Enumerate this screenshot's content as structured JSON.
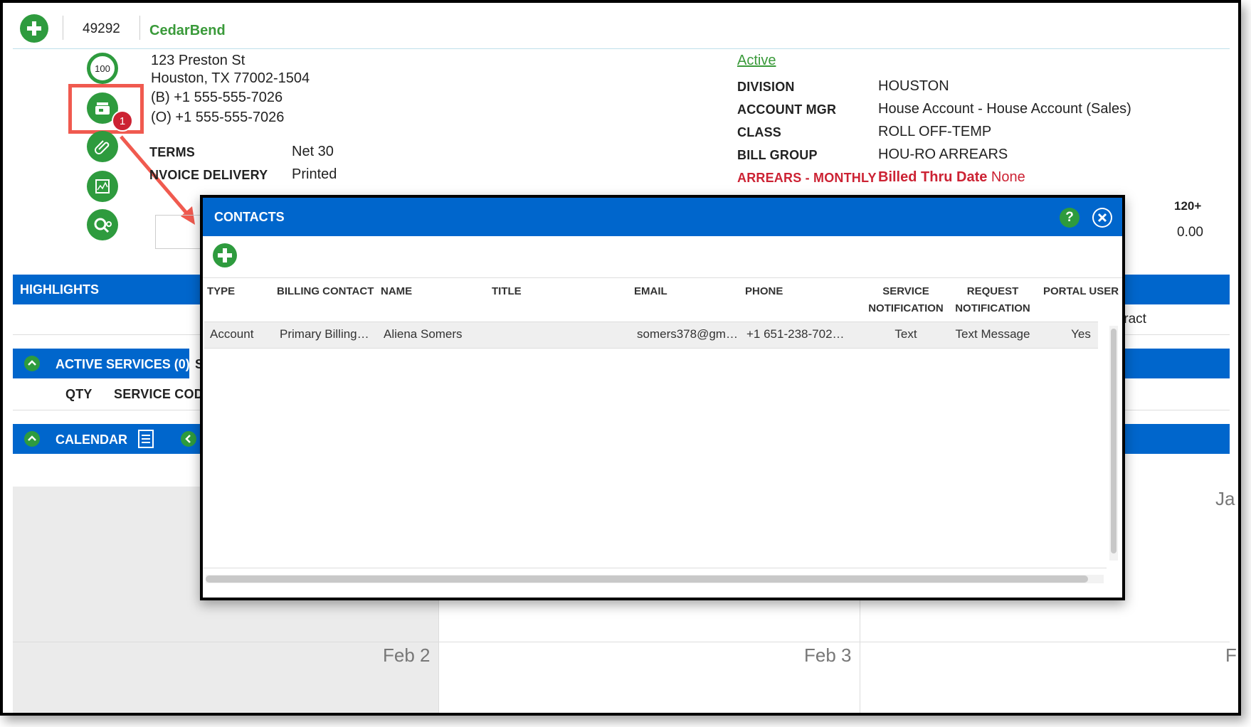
{
  "account": {
    "number": "49292",
    "name": "CedarBend",
    "score": "100",
    "address_line1": "123 Preston St",
    "address_line2": "Houston, TX 77002-1504",
    "phone_b": "(B) +1 555-555-7026",
    "phone_o": "(O) +1 555-555-7026",
    "contacts_badge": "1",
    "status": "Active"
  },
  "terms": {
    "terms_label": "TERMS",
    "terms_value": "Net 30",
    "delivery_label": "NVOICE DELIVERY",
    "delivery_value": "Printed"
  },
  "details": {
    "division_label": "DIVISION",
    "division_value": "HOUSTON",
    "mgr_label": "ACCOUNT MGR",
    "mgr_value": "House Account - House Account (Sales)",
    "class_label": "CLASS",
    "class_value": "ROLL OFF-TEMP",
    "billgroup_label": "BILL GROUP",
    "billgroup_value": "HOU-RO ARREARS",
    "arrears_label": "ARREARS - MONTHLY",
    "billed_thru_label": "Billed Thru Date",
    "billed_thru_value": "None"
  },
  "aging": {
    "bucket_label": "120+",
    "bucket_value": "0.00"
  },
  "sections": {
    "highlights": "HIGHLIGHTS",
    "active_services": "ACTIVE SERVICES (0)",
    "active_services_trunc": "S",
    "qty": "QTY",
    "service_code": "SERVICE CODE",
    "calendar": "CALENDAR",
    "contract_trunc": "tract"
  },
  "calendar": {
    "day1": "Feb 2",
    "day2": "Feb 3",
    "trunc_right": "F",
    "trunc_top": "Ja"
  },
  "modal": {
    "title": "CONTACTS",
    "help": "?",
    "columns": {
      "type": "TYPE",
      "billing_contact": "BILLING CONTACT",
      "name": "NAME",
      "title": "TITLE",
      "email": "EMAIL",
      "phone": "PHONE",
      "service_notification_1": "SERVICE",
      "service_notification_2": "NOTIFICATION",
      "request_notification_1": "REQUEST",
      "request_notification_2": "NOTIFICATION",
      "portal_user": "PORTAL USER"
    },
    "rows": [
      {
        "type": "Account",
        "billing_contact": "Primary Billing…",
        "name": "Aliena Somers",
        "title": "",
        "email": "somers378@gm…",
        "phone": "+1 651-238-702…",
        "service_notification": "Text",
        "request_notification": "Text Message",
        "portal_user": "Yes"
      }
    ]
  },
  "colors": {
    "brand_blue": "#0066cc",
    "green": "#2e9b3e",
    "alert_red": "#cc2233",
    "highlight_box": "#f05a4f"
  }
}
